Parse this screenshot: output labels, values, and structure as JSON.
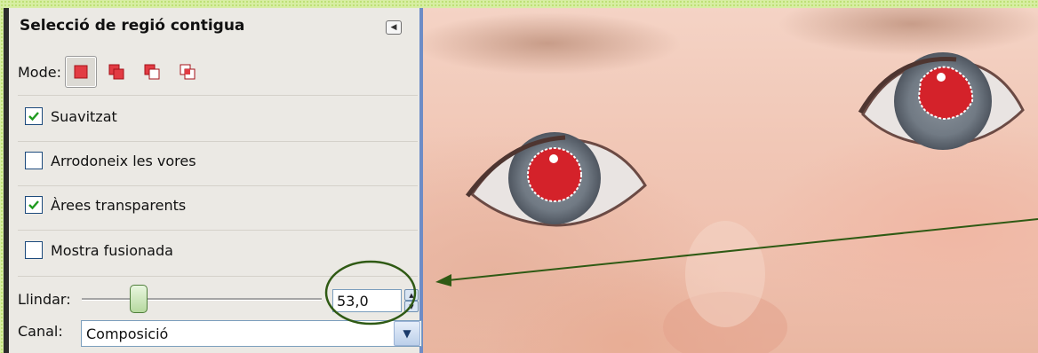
{
  "panel": {
    "title": "Selecció de regió contigua",
    "mode_label": "Mode:",
    "mode_buttons": [
      {
        "icon": "replace-selection-icon",
        "active": true
      },
      {
        "icon": "add-selection-icon",
        "active": false
      },
      {
        "icon": "subtract-selection-icon",
        "active": false
      },
      {
        "icon": "intersect-selection-icon",
        "active": false
      }
    ],
    "options": [
      {
        "label": "Suavitzat",
        "checked": true
      },
      {
        "label": "Arrodoneix les vores",
        "checked": false
      },
      {
        "label": "Àrees transparents",
        "checked": true
      },
      {
        "label": "Mostra fusionada",
        "checked": false
      }
    ],
    "threshold": {
      "label": "Llindar:",
      "value": "53,0"
    },
    "channel": {
      "label": "Canal:",
      "value": "Composició"
    }
  },
  "colors": {
    "accent_green": "#2f5a14",
    "selection_red": "#d4222a",
    "iris_gray": "#7f8790"
  }
}
